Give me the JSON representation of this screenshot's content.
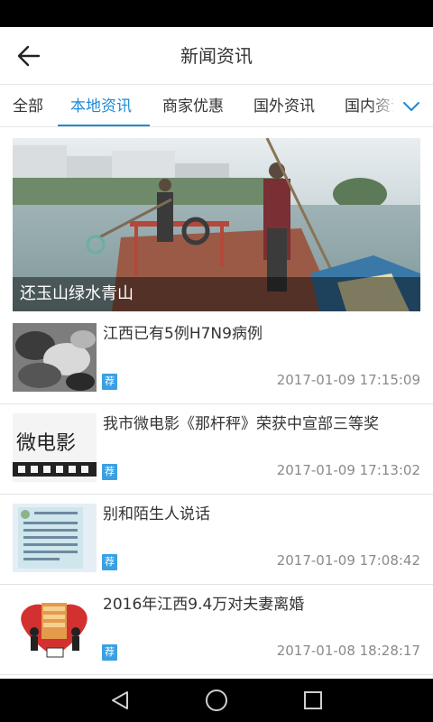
{
  "header": {
    "title": "新闻资讯",
    "back_icon": "arrow-left-icon"
  },
  "tabs": [
    {
      "label": "全部",
      "active": false
    },
    {
      "label": "本地资讯",
      "active": true
    },
    {
      "label": "商家优惠",
      "active": false
    },
    {
      "label": "国外资讯",
      "active": false
    },
    {
      "label": "国内资讯",
      "active": false
    }
  ],
  "tabs_more_icon": "chevron-down-icon",
  "feature": {
    "caption": "还玉山绿水青山"
  },
  "news": [
    {
      "title": "江西已有5例H7N9病例",
      "tag": "荐",
      "time": "2017-01-09 17:15:09"
    },
    {
      "title": "我市微电影《那杆秤》荣获中宣部三等奖",
      "tag": "荐",
      "time": "2017-01-09 17:13:02",
      "thumb_text": "微电影"
    },
    {
      "title": "别和陌生人说话",
      "tag": "荐",
      "time": "2017-01-09 17:08:42"
    },
    {
      "title": "2016年江西9.4万对夫妻离婚",
      "tag": "荐",
      "time": "2017-01-08 18:28:17"
    }
  ],
  "colors": {
    "accent": "#1e8ad6",
    "tag": "#3aa0e3",
    "time": "#8a8a8a"
  }
}
